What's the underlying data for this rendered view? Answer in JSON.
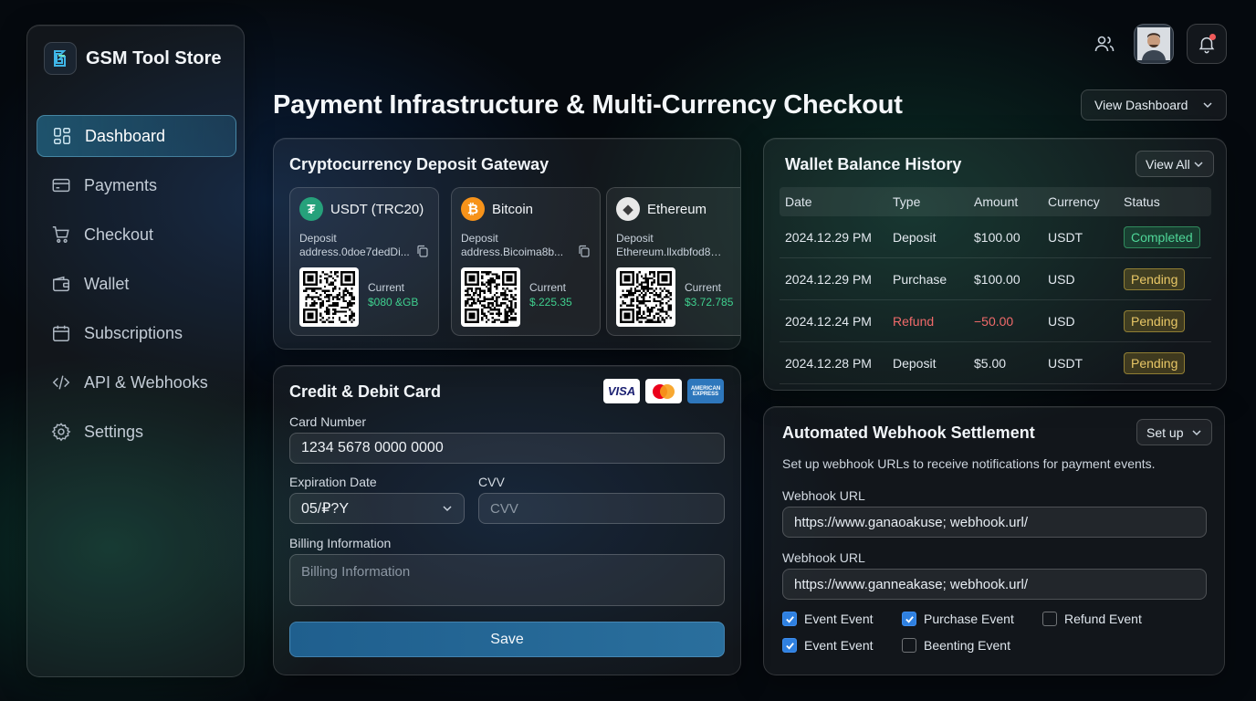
{
  "brand": {
    "name": "GSM Tool Store"
  },
  "sidebar": {
    "items": [
      {
        "label": "Dashboard",
        "icon": "dashboard-icon",
        "active": true
      },
      {
        "label": "Payments",
        "icon": "card-icon"
      },
      {
        "label": "Checkout",
        "icon": "cart-icon"
      },
      {
        "label": "Wallet",
        "icon": "wallet-icon"
      },
      {
        "label": "Subscriptions",
        "icon": "calendar-icon"
      },
      {
        "label": "API & Webhooks",
        "icon": "code-icon"
      },
      {
        "label": "Settings",
        "icon": "gear-icon"
      }
    ]
  },
  "header": {
    "title": "Payment Infrastructure & Multi-Currency Checkout",
    "view_dashboard": "View Dashboard"
  },
  "crypto": {
    "title": "Cryptocurrency Deposit Gateway",
    "coins": [
      {
        "name": "USDT (TRC20)",
        "deposit_label": "Deposit",
        "address": "address.0doe7dedDi...",
        "current_label": "Current",
        "current_value": "$080 &GB",
        "color": "#26a17b",
        "glyph": "₮"
      },
      {
        "name": "Bitcoin",
        "deposit_label": "Deposit",
        "address": "address.Bicoima8b...",
        "current_label": "Current",
        "current_value": "$.225.35",
        "color": "#f7931a",
        "glyph": "₿"
      },
      {
        "name": "Ethereum",
        "deposit_label": "Deposit",
        "address": "Ethereum.llxdbfod88b...",
        "current_label": "Current",
        "current_value": "$3.72.785",
        "color": "#e8e8e8",
        "glyph": "◆"
      }
    ]
  },
  "card": {
    "title": "Credit & Debit Card",
    "logos": {
      "visa": "VISA",
      "amex": "AMERICAN EXPRESS"
    },
    "card_number_label": "Card Number",
    "card_number_value": "1234 5678 0000 0000",
    "expiration_label": "Expiration Date",
    "expiration_value": "05/₽?Y",
    "cvv_label": "CVV",
    "cvv_placeholder": "CVV",
    "billing_label": "Billing Information",
    "billing_placeholder": "Billing Information",
    "save_label": "Save"
  },
  "wallet": {
    "title": "Wallet Balance History",
    "view_all": "View All",
    "columns": [
      "Date",
      "Type",
      "Amount",
      "Currency",
      "Status"
    ],
    "rows": [
      {
        "date": "2024.12.29 PM",
        "type": "Deposit",
        "amount": "$100.00",
        "currency": "USDT",
        "status": "Completed"
      },
      {
        "date": "2024.12.29 PM",
        "type": "Purchase",
        "amount": "$100.00",
        "currency": "USD",
        "status": "Pending"
      },
      {
        "date": "2024.12.24 PM",
        "type": "Refund",
        "amount": "−50.00",
        "currency": "USD",
        "status": "Pending"
      },
      {
        "date": "2024.12.28 PM",
        "type": "Deposit",
        "amount": "$5.00",
        "currency": "USDT",
        "status": "Pending"
      }
    ]
  },
  "webhook": {
    "title": "Automated Webhook Settlement",
    "setup": "Set up",
    "description": "Set up webhook URLs to receive notifications for payment events.",
    "url1_label": "Webhook URL",
    "url1_value": "https://www.ganaoakuse; webhook.url/",
    "url2_label": "Webhook URL",
    "url2_value": "https://www.ganneakase; webhook.url/",
    "events": [
      {
        "label": "Event Event",
        "checked": true
      },
      {
        "label": "Purchase Event",
        "checked": true
      },
      {
        "label": "Refund Event",
        "checked": false
      },
      {
        "label": "Event Event",
        "checked": true
      },
      {
        "label": "Beenting Event",
        "checked": false
      }
    ]
  },
  "colors": {
    "accent": "#2f80e0",
    "success": "#4fd698",
    "pending": "#e8c766",
    "danger": "#f06a6a"
  }
}
